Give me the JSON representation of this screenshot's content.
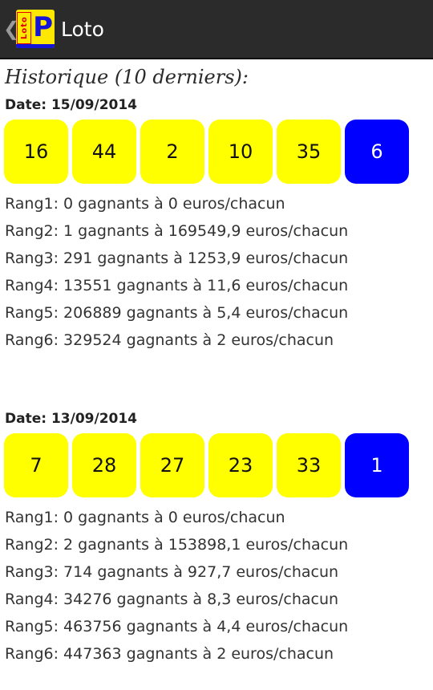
{
  "actionbar": {
    "back_glyph": "❮",
    "title": "Loto",
    "logo_word": "Loto",
    "logo_letter": "P",
    "colors": {
      "background": "#2b2b2b",
      "logo_yellow": "#ffe800",
      "logo_red": "#e00000",
      "logo_blue": "#1515d8"
    }
  },
  "history_heading": "Historique (10 derniers):",
  "colors": {
    "main_ball": "#ffff00",
    "bonus_ball": "#0000ff"
  },
  "draws": [
    {
      "date": "Date: 15/09/2014",
      "balls": [
        "16",
        "44",
        "2",
        "10",
        "35"
      ],
      "bonus": "6",
      "ranks": [
        "Rang1: 0 gagnants à 0 euros/chacun",
        "Rang2: 1 gagnants à 169549,9 euros/chacun",
        "Rang3: 291 gagnants à 1253,9 euros/chacun",
        "Rang4: 13551 gagnants à 11,6 euros/chacun",
        "Rang5: 206889 gagnants à 5,4 euros/chacun",
        "Rang6: 329524 gagnants à 2 euros/chacun"
      ]
    },
    {
      "date": "Date: 13/09/2014",
      "balls": [
        "7",
        "28",
        "27",
        "23",
        "33"
      ],
      "bonus": "1",
      "ranks": [
        "Rang1: 0 gagnants à 0 euros/chacun",
        "Rang2: 2 gagnants à 153898,1 euros/chacun",
        "Rang3: 714 gagnants à 927,7 euros/chacun",
        "Rang4: 34276 gagnants à 8,3 euros/chacun",
        "Rang5: 463756 gagnants à 4,4 euros/chacun",
        "Rang6: 447363 gagnants à 2 euros/chacun"
      ]
    }
  ]
}
